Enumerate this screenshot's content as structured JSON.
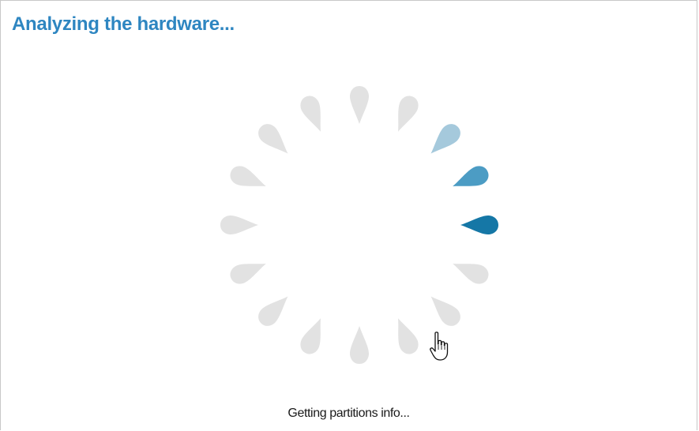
{
  "header": {
    "title": "Analyzing the hardware..."
  },
  "spinner": {
    "icon": "loading-spinner-icon",
    "segment_count": 16,
    "active_index": 4,
    "colors": {
      "inactive": "#e2e2e2",
      "active": "#1577a6",
      "trail_1": "#4c9cc4",
      "trail_2": "#a5c9dc"
    }
  },
  "status": {
    "text": "Getting partitions info..."
  },
  "cursor": {
    "icon": "hand-pointer-icon"
  }
}
